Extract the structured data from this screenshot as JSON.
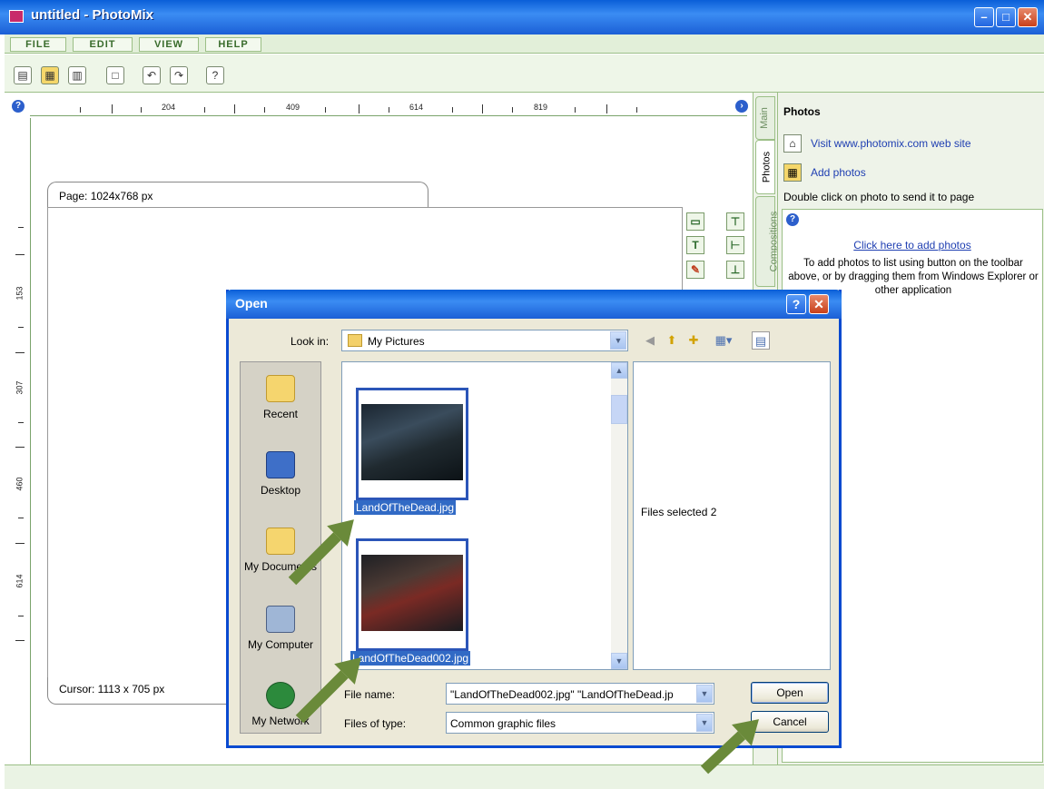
{
  "window": {
    "title": "untitled - PhotoMix"
  },
  "menu": [
    {
      "label": "FILE"
    },
    {
      "label": "EDIT"
    },
    {
      "label": "VIEW"
    },
    {
      "label": "HELP"
    }
  ],
  "ruler": {
    "top_labels": [
      "204",
      "409",
      "614",
      "819"
    ],
    "side_labels": [
      "153",
      "307",
      "460",
      "614"
    ]
  },
  "canvas": {
    "page_label": "Page: 1024x768 px",
    "cursor_label": "Cursor: 1113 x 705 px"
  },
  "side_tabs": [
    {
      "label": "Main"
    },
    {
      "label": "Photos"
    },
    {
      "label": "Compositions"
    }
  ],
  "panel": {
    "title": "Photos",
    "visit_link": "Visit www.photomix.com web site",
    "add_photos": "Add photos",
    "hint": "Double click on photo to send it to page",
    "click_here": "Click here to add photos",
    "help_text": "To add photos to list using button on the toolbar above, or by dragging them from Windows Explorer or other application"
  },
  "dialog": {
    "title": "Open",
    "look_in_label": "Look in:",
    "look_in_value": "My Pictures",
    "places": [
      {
        "label": "Recent"
      },
      {
        "label": "Desktop"
      },
      {
        "label": "My Documents"
      },
      {
        "label": "My Computer"
      },
      {
        "label": "My Network"
      }
    ],
    "files": [
      {
        "name": "LandOfTheDead.jpg"
      },
      {
        "name": "LandOfTheDead002.jpg"
      }
    ],
    "preview_text": "Files selected  2",
    "file_name_label": "File name:",
    "file_name_value": "\"LandOfTheDead002.jpg\" \"LandOfTheDead.jp",
    "file_type_label": "Files of type:",
    "file_type_value": "Common graphic files",
    "open_label": "Open",
    "cancel_label": "Cancel"
  }
}
